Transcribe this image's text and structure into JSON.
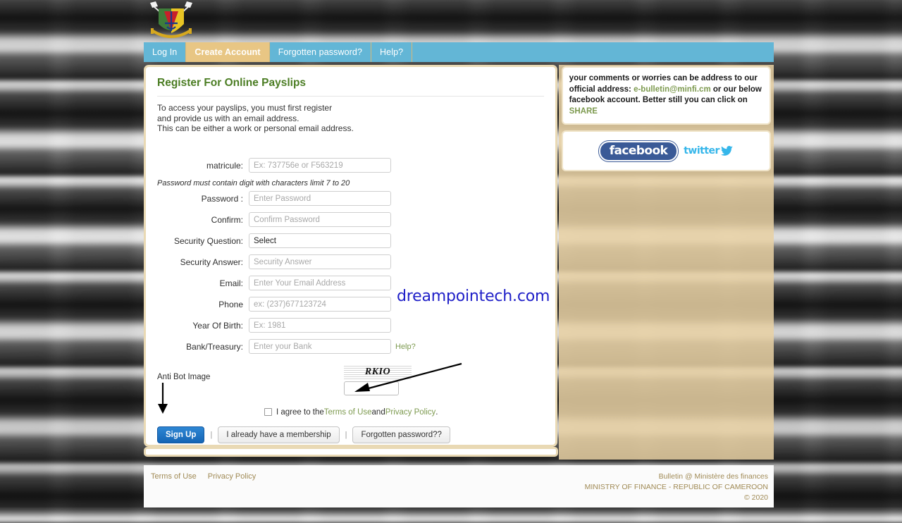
{
  "nav": {
    "tabs": [
      {
        "label": "Log In",
        "active": false
      },
      {
        "label": "Create Account",
        "active": true
      },
      {
        "label": "Forgotten password?",
        "active": false
      },
      {
        "label": "Help?",
        "active": false
      }
    ]
  },
  "main": {
    "title": "Register For Online Payslips",
    "intro_line1": "To access your payslips, you must first register",
    "intro_line2": "and provide us with an email address.",
    "intro_line3": "This can be either a work or personal email address.",
    "password_hint": "Password must contain digit with characters limit 7 to 20",
    "fields": {
      "matricule_label": "matricule:",
      "matricule_placeholder": "Ex: 737756e or F563219",
      "matricule_value": "",
      "password_label": "Password :",
      "password_placeholder": "Enter Password",
      "password_value": "",
      "confirm_label": "Confirm:",
      "confirm_placeholder": "Confirm Password",
      "confirm_value": "",
      "security_question_label": "Security Question:",
      "security_question_selected": "Select",
      "security_answer_label": "Security Answer:",
      "security_answer_placeholder": "Security Answer",
      "security_answer_value": "",
      "email_label": "Email:",
      "email_placeholder": "Enter Your Email Address",
      "email_value": "",
      "phone_label": "Phone",
      "phone_placeholder": "ex: (237)677123724",
      "phone_value": "",
      "year_label": "Year Of Birth:",
      "year_placeholder": "Ex: 1981",
      "year_value": "",
      "bank_label": "Bank/Treasury:",
      "bank_placeholder": "Enter your Bank",
      "bank_value": "",
      "bank_help": "Help?"
    },
    "antibot": {
      "label": "Anti Bot Image",
      "captcha_text": "RKIO",
      "input_value": ""
    },
    "terms": {
      "prefix": "I agree to the ",
      "terms_link": "Terms of Use",
      "middle": " and ",
      "privacy_link": "Privacy Policy",
      "suffix": ".",
      "checked": false
    },
    "buttons": {
      "signup": "Sign Up",
      "membership": "I already have a membership",
      "forgotten": "Forgotten password??",
      "separator": "|"
    }
  },
  "sidebar": {
    "text_prefix": "your comments or worries can be address to our official address: ",
    "email": "e-bulletin@minfi.cm",
    "text_middle": " or our below facebook account. Better still you can click on ",
    "share": "SHARE",
    "facebook_label": "facebook",
    "twitter_label": "twitter"
  },
  "footer": {
    "terms_of_use": "Terms of Use",
    "privacy_policy": "Privacy Policy",
    "line1": "Bulletin @ Ministère des finances",
    "line2": "MINISTRY OF FINANCE - REPUBLIC OF CAMEROON",
    "line3": "© 2020"
  },
  "watermark": {
    "text": "dreampointech.com"
  },
  "colors": {
    "nav_blue": "#63b6d6",
    "nav_active_tan": "#e8c684",
    "title_green": "#4b7d23",
    "link_green": "#7d9a4f",
    "primary_blue": "#1565b5",
    "sidebar_tan": "#e8d1a3",
    "footer_tan": "#a08a55",
    "watermark_blue": "#2020c8"
  }
}
